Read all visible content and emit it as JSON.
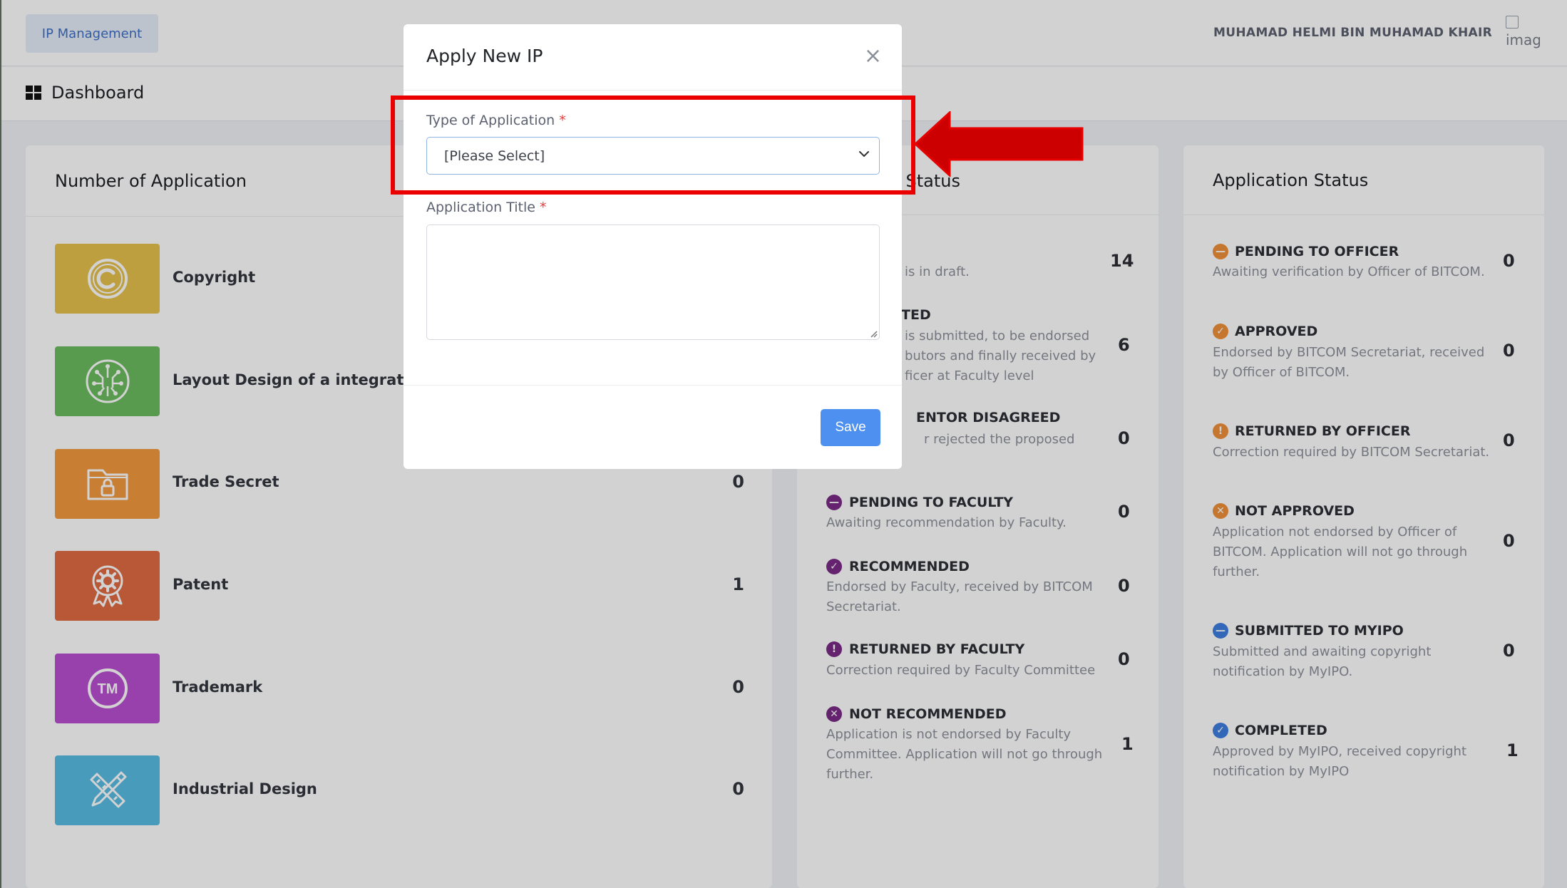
{
  "topbar": {
    "brand_label": "IP Management",
    "user_name": "MUHAMAD HELMI BIN MUHAMAD KHAIR",
    "avatar_alt": "imag"
  },
  "subbar": {
    "title": "Dashboard"
  },
  "number_card": {
    "title": "Number of Application",
    "items": [
      {
        "label": "Copyright",
        "count": "",
        "color": "#e7c14d",
        "icon": "copyright-icon"
      },
      {
        "label": "Layout Design of a integrated Cir",
        "count": "",
        "color": "#6bbd5f",
        "icon": "circuit-icon"
      },
      {
        "label": "Trade Secret",
        "count": "0",
        "color": "#f39a3f",
        "icon": "locked-folder-icon"
      },
      {
        "label": "Patent",
        "count": "1",
        "color": "#e06b43",
        "icon": "award-gear-icon"
      },
      {
        "label": "Trademark",
        "count": "0",
        "color": "#b94ed1",
        "icon": "trademark-icon"
      },
      {
        "label": "Industrial Design",
        "count": "0",
        "color": "#58bde4",
        "icon": "ruler-pencil-icon"
      }
    ]
  },
  "faculty_card": {
    "title": "on Status",
    "items": [
      {
        "title": "",
        "desc": "is in draft.",
        "count": "14",
        "icon_color": ""
      },
      {
        "title": "TED",
        "desc": "is submitted, to be endorsed butors and finally received by ficer at Faculty level",
        "count": "6",
        "icon_color": ""
      },
      {
        "title": "ENTOR DISAGREED",
        "desc": "r rejected the proposed",
        "count": "0",
        "icon_color": ""
      },
      {
        "title": "PENDING TO FACULTY",
        "desc": "Awaiting recommendation by Faculty.",
        "count": "0",
        "icon_color": "#7b2a86",
        "icon": "minus-circle-icon"
      },
      {
        "title": "RECOMMENDED",
        "desc": "Endorsed by Faculty, received by BITCOM Secretariat.",
        "count": "0",
        "icon_color": "#7b2a86",
        "icon": "check-circle-icon"
      },
      {
        "title": "RETURNED BY FACULTY",
        "desc": "Correction required by Faculty Committee",
        "count": "0",
        "icon_color": "#7b2a86",
        "icon": "exclamation-circle-icon"
      },
      {
        "title": "NOT RECOMMENDED",
        "desc": "Application is not endorsed by Faculty Committee. Application will not go through further.",
        "count": "1",
        "icon_color": "#7b2a86",
        "icon": "x-circle-icon"
      }
    ]
  },
  "status_card": {
    "title": "Application Status",
    "items": [
      {
        "title": "PENDING TO OFFICER",
        "desc": "Awaiting verification by Officer of BITCOM.",
        "count": "0",
        "icon_color": "#f0913a",
        "icon": "minus-circle-icon"
      },
      {
        "title": "APPROVED",
        "desc": "Endorsed by BITCOM Secretariat, received by Officer of BITCOM.",
        "count": "0",
        "icon_color": "#f0913a",
        "icon": "check-circle-icon"
      },
      {
        "title": "RETURNED BY OFFICER",
        "desc": "Correction required by BITCOM Secretariat.",
        "count": "0",
        "icon_color": "#f0913a",
        "icon": "exclamation-circle-icon"
      },
      {
        "title": "NOT APPROVED",
        "desc": "Application not endorsed by Officer of BITCOM. Application will not go through further.",
        "count": "0",
        "icon_color": "#f0913a",
        "icon": "x-circle-icon"
      },
      {
        "title": "SUBMITTED TO MYIPO",
        "desc": "Submitted and awaiting copyright notification by MyIPO.",
        "count": "0",
        "icon_color": "#3f7fe0",
        "icon": "minus-circle-icon"
      },
      {
        "title": "COMPLETED",
        "desc": "Approved by MyIPO, received copyright notification by MyIPO",
        "count": "1",
        "icon_color": "#3f7fe0",
        "icon": "check-circle-icon"
      }
    ]
  },
  "modal": {
    "title": "Apply New IP",
    "close_symbol": "×",
    "type_label": "Type of Application",
    "type_value": "[Please Select]",
    "title_label": "Application Title",
    "title_value": "",
    "required_mark": "*",
    "save_label": "Save"
  },
  "annotation": {
    "highlight_color": "#ea0000",
    "arrow_color": "#cc0000"
  }
}
